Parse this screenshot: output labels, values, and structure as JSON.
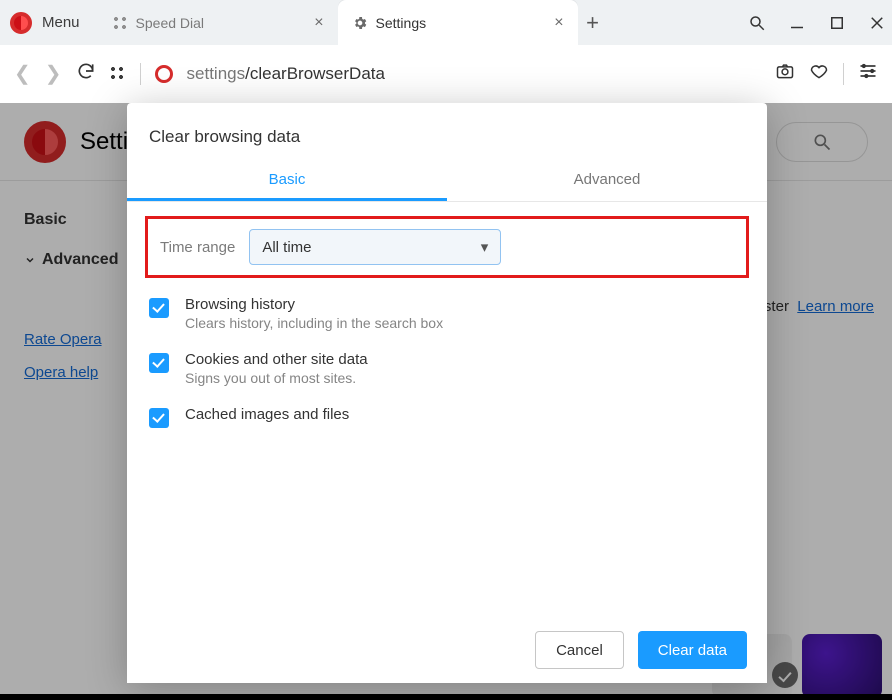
{
  "titlebar": {
    "menu_label": "Menu",
    "tabs": [
      {
        "label": "Speed Dial"
      },
      {
        "label": "Settings"
      }
    ],
    "new_tab_glyph": "+"
  },
  "address": {
    "host": "settings",
    "path": "/clearBrowserData"
  },
  "page": {
    "title": "Settings",
    "side_basic": "Basic",
    "side_advanced": "Advanced",
    "rate_link": "Rate Opera",
    "help_link": "Opera help",
    "promo_text": "faster",
    "promo_link": "Learn more"
  },
  "dialog": {
    "title": "Clear browsing data",
    "tabs": {
      "basic": "Basic",
      "advanced": "Advanced"
    },
    "time_range_label": "Time range",
    "time_range_value": "All time",
    "options": [
      {
        "title": "Browsing history",
        "sub": "Clears history, including in the search box",
        "checked": true
      },
      {
        "title": "Cookies and other site data",
        "sub": "Signs you out of most sites.",
        "checked": true
      },
      {
        "title": "Cached images and files",
        "sub": "",
        "checked": true
      }
    ],
    "cancel_label": "Cancel",
    "clear_label": "Clear data"
  }
}
